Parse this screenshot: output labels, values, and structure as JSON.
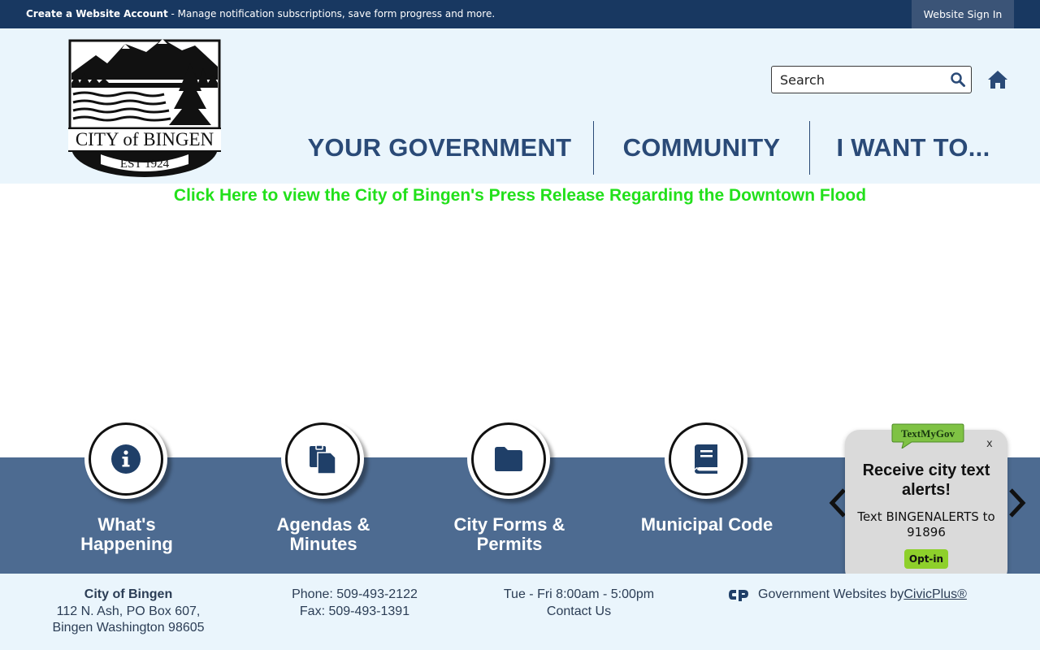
{
  "topbar": {
    "create_account": "Create a Website Account",
    "create_desc": " - Manage notification subscriptions, save form progress and more.",
    "sign_in": "Website Sign In"
  },
  "header": {
    "logo_text": "CITY of BINGEN",
    "logo_est": "EST 1924",
    "search_placeholder": "Search",
    "nav": [
      "YOUR GOVERNMENT",
      "COMMUNITY",
      "I WANT TO..."
    ]
  },
  "alert_link": "Click Here to view the City of Bingen's Press Release Regarding the Downtown Flood",
  "quick_links": [
    {
      "label": "What's Happening",
      "icon": "info-icon"
    },
    {
      "label": "Agendas & Minutes",
      "icon": "documents-icon"
    },
    {
      "label": "City Forms & Permits",
      "icon": "folder-icon"
    },
    {
      "label": "Municipal Code",
      "icon": "book-icon"
    }
  ],
  "textmygov": {
    "badge": "TextMyGov",
    "close": "x",
    "heading": "Receive city text alerts!",
    "body": "Text BINGENALERTS to 91896",
    "button": "Opt-in"
  },
  "footer": {
    "name": "City of Bingen",
    "address1": "112 N. Ash, PO Box 607,",
    "address2": "Bingen Washington 98605",
    "phone": "Phone: 509-493-2122",
    "fax": "Fax: 509-493-1391",
    "hours": "Tue - Fri 8:00am - 5:00pm",
    "contact": "Contact Us",
    "gov_sites": "Government Websites by ",
    "civicplus": "CivicPlus®"
  },
  "colors": {
    "topbar": "#183861",
    "header_bg": "#eaf5fc",
    "nav_text": "#2a4a77",
    "alert_green": "#22e01b",
    "band": "#4d6b91",
    "optin": "#8ed02b"
  }
}
